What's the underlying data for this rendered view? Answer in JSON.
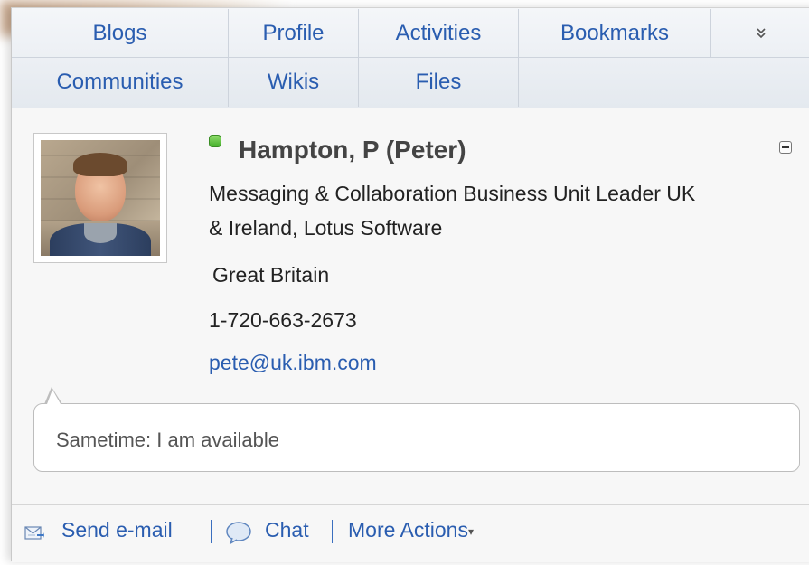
{
  "tabs": {
    "row1": [
      "Blogs",
      "Profile",
      "Activities",
      "Bookmarks"
    ],
    "more": "»",
    "row2": [
      "Communities",
      "Wikis",
      "Files"
    ]
  },
  "profile": {
    "name": "Hampton, P (Peter)",
    "title_line1": "Messaging & Collaboration Business Unit Leader UK",
    "title_line2": "& Ireland, Lotus Software",
    "location": "Great Britain",
    "phone": "1-720-663-2673",
    "email": "pete@uk.ibm.com",
    "status": "Sametime: I am available",
    "status_color": "#46b02c"
  },
  "actions": {
    "send_email": "Send e-mail",
    "chat": "Chat",
    "more": "More Actions"
  },
  "icons": {
    "mail": "envelope-icon",
    "chat": "chat-bubble-icon",
    "collapse": "collapse-icon",
    "more_tabs": "double-chevron-down-icon"
  },
  "colors": {
    "link": "#2a5db0",
    "tab_bg": "#e4e9ef"
  }
}
